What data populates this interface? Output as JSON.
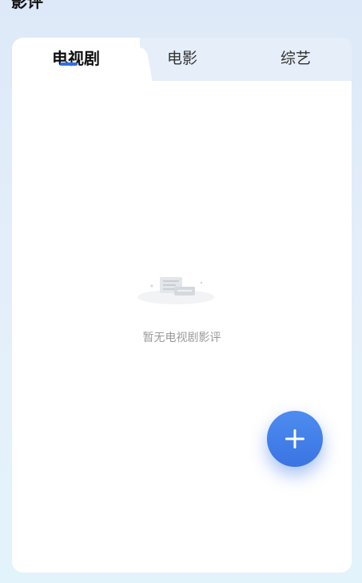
{
  "header": {
    "title": "影评"
  },
  "tabs": [
    {
      "label": "电视剧",
      "active": true
    },
    {
      "label": "电影",
      "active": false
    },
    {
      "label": "综艺",
      "active": false
    }
  ],
  "empty_state": {
    "text": "暂无电视剧影评",
    "icon": "empty-document-icon"
  },
  "fab": {
    "icon": "plus-icon"
  },
  "colors": {
    "accent": "#2f6fe6",
    "fab": "#3f7be8",
    "empty_text": "#9a9a9a"
  }
}
